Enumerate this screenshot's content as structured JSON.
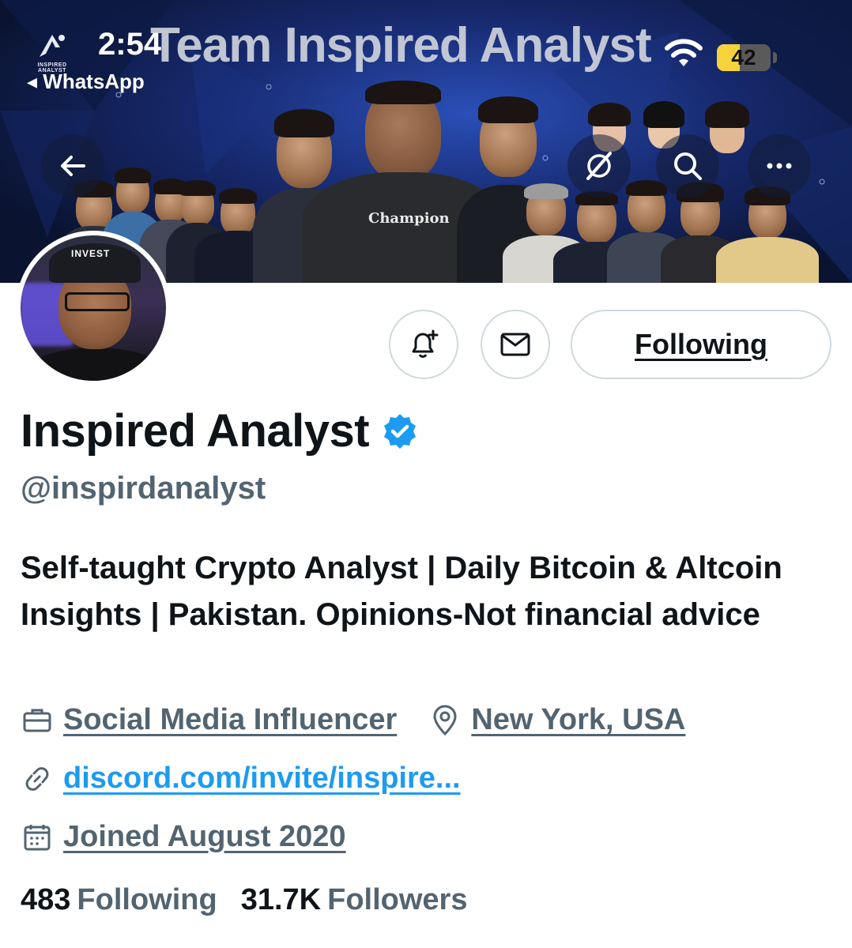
{
  "status_bar": {
    "time": "2:54",
    "back_app": "◂ WhatsApp",
    "battery_level": "42",
    "battery_fraction": 0.42
  },
  "banner": {
    "title": "Team Inspired Analyst",
    "logo_text": "INSPIRED ANALYST"
  },
  "nav": {
    "back_icon": "arrow-left-icon",
    "grok_icon": "grok-icon",
    "search_icon": "search-icon",
    "more_icon": "more-horizontal-icon"
  },
  "actions": {
    "notify_icon": "bell-plus-icon",
    "message_icon": "envelope-icon",
    "following_label": "Following"
  },
  "profile": {
    "display_name": "Inspired Analyst",
    "handle": "@inspirdanalyst",
    "bio": "Self-taught Crypto Analyst | Daily Bitcoin & Altcoin Insights | Pakistan. Opinions-Not financial advice",
    "category": "Social Media Influencer",
    "location": "New York, USA",
    "website": "discord.com/invite/inspire...",
    "joined": "Joined August 2020",
    "following_count": "483",
    "following_label": "Following",
    "followers_count": "31.7K",
    "followers_label": "Followers"
  },
  "colors": {
    "accent": "#1d9bf0",
    "secondary_text": "#536471",
    "primary_text": "#0f1419",
    "border": "#cfd9de",
    "battery": "#f5d33a"
  }
}
